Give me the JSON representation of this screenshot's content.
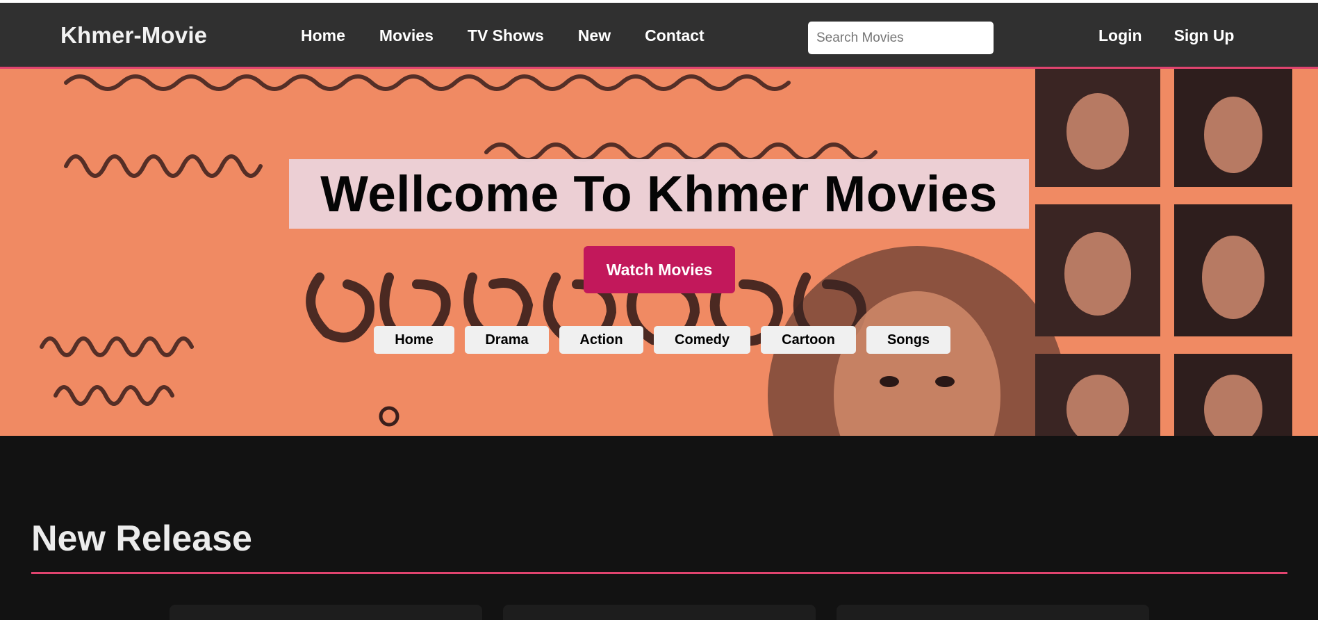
{
  "header": {
    "brand": "Khmer-Movie",
    "nav": [
      {
        "label": "Home"
      },
      {
        "label": "Movies"
      },
      {
        "label": "TV Shows"
      },
      {
        "label": "New"
      },
      {
        "label": "Contact"
      }
    ],
    "search": {
      "placeholder": "Search Movies",
      "value": ""
    },
    "auth": {
      "login": "Login",
      "signup": "Sign Up"
    }
  },
  "hero": {
    "title": "Wellcome To Khmer Movies",
    "cta": "Watch Movies",
    "categories": [
      {
        "label": "Home"
      },
      {
        "label": "Drama"
      },
      {
        "label": "Action"
      },
      {
        "label": "Comedy"
      },
      {
        "label": "Cartoon"
      },
      {
        "label": "Songs"
      }
    ]
  },
  "section": {
    "title": "New Release"
  },
  "colors": {
    "accent": "#e0446f",
    "cta": "#c2185b",
    "navbar": "#303030",
    "page_bg": "#121212",
    "hero_bg": "#f08a63"
  }
}
